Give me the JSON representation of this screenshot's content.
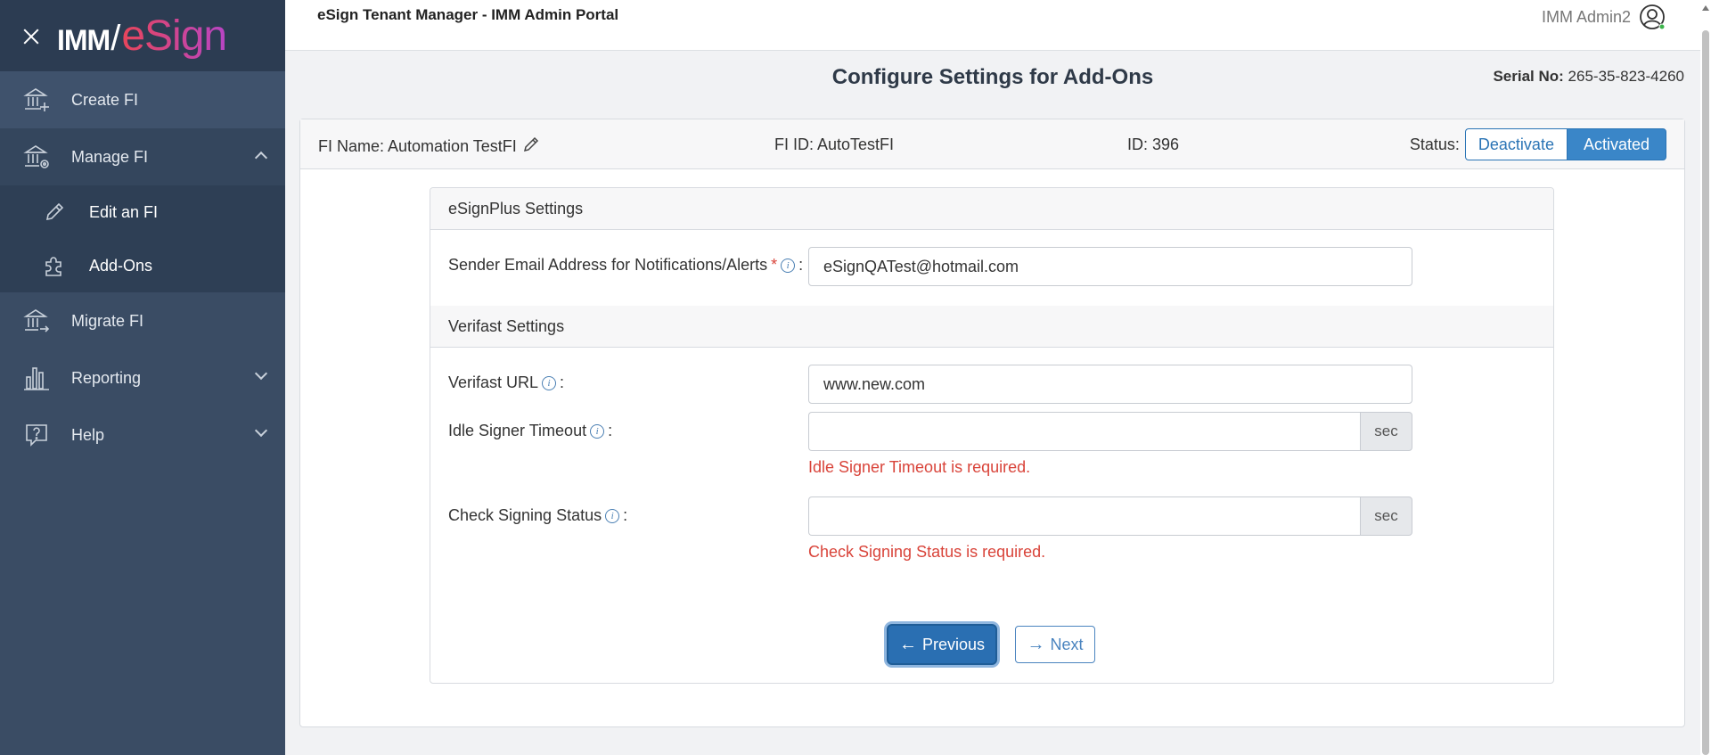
{
  "app": {
    "title": "eSign Tenant Manager - IMM Admin Portal",
    "user_name": "IMM Admin2"
  },
  "brand": {
    "part1": "IMM",
    "slash": "/",
    "part2": "eSign"
  },
  "sidebar": {
    "items": [
      {
        "label": "Create FI",
        "icon": "bank-plus-icon"
      },
      {
        "label": "Manage FI",
        "icon": "bank-gear-icon",
        "expanded": true,
        "children": [
          {
            "label": "Edit an FI",
            "icon": "pencil-icon"
          },
          {
            "label": "Add-Ons",
            "icon": "puzzle-icon"
          }
        ]
      },
      {
        "label": "Migrate FI",
        "icon": "bank-arrow-icon"
      },
      {
        "label": "Reporting",
        "icon": "bar-chart-icon"
      },
      {
        "label": "Help",
        "icon": "help-bubble-icon"
      }
    ]
  },
  "page": {
    "title": "Configure Settings for Add-Ons",
    "serial_label": "Serial No:",
    "serial_value": "265-35-823-4260"
  },
  "fi": {
    "name": "FI Name: Automation TestFI",
    "fi_id": "FI ID: AutoTestFI",
    "id": "ID: 396",
    "status_label": "Status:",
    "deactivate_label": "Deactivate",
    "activated_label": "Activated",
    "status": "Activated"
  },
  "esignplus": {
    "heading": "eSignPlus Settings",
    "sender_email_label": "Sender Email Address for Notifications/Alerts",
    "required_mark": "*",
    "colon": ":",
    "sender_email_value": "eSignQATest@hotmail.com"
  },
  "verifast": {
    "heading": "Verifast Settings",
    "url_label": "Verifast URL",
    "url_value": "www.new.com",
    "idle_label": "Idle Signer Timeout",
    "idle_value": "",
    "idle_unit": "sec",
    "idle_error": "Idle Signer Timeout is required.",
    "check_label": "Check Signing Status",
    "check_value": "",
    "check_unit": "sec",
    "check_error": "Check Signing Status is required.",
    "info_glyph": "i",
    "colon": ":"
  },
  "nav_buttons": {
    "previous": "Previous",
    "next": "Next",
    "prev_arrow": "←",
    "next_arrow": "→"
  },
  "colors": {
    "sidebar": "#3a4c64",
    "primary": "#2a74b5",
    "error": "#d9443a",
    "brand_gradient_start": "#e8455a",
    "brand_gradient_end": "#b845c5"
  }
}
